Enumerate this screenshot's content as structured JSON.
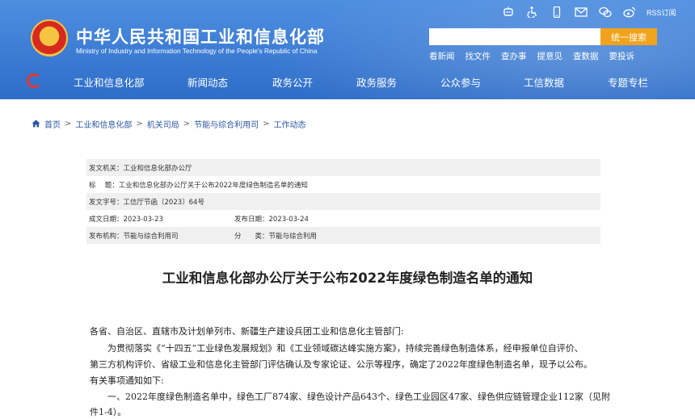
{
  "header": {
    "title": "中华人民共和国工业和信息化部",
    "subtitle": "Ministry of Industry and Information Technology of the People's Republic of China",
    "rss_label": "RSS订阅",
    "search": {
      "placeholder": "",
      "button_label": "统一搜索"
    },
    "quick_links": [
      "看新闻",
      "找文件",
      "查办事",
      "提意见",
      "查数据",
      "要投诉"
    ],
    "top_icons": [
      "robot-icon",
      "accessibility-icon",
      "mobile-icon",
      "mail-icon",
      "wechat-icon",
      "weibo-icon"
    ]
  },
  "nav": {
    "items": [
      "工业和信息化部",
      "新闻动态",
      "政务公开",
      "政务服务",
      "公众参与",
      "工信数据",
      "专题专栏"
    ]
  },
  "breadcrumb": [
    "首页",
    "工业和信息化部",
    "机关司局",
    "节能与综合利用司",
    "工作动态"
  ],
  "meta": {
    "issuer": "发文机关：工业和信息化部办公厅",
    "subject": "标　 题：工业和信息化部办公厅关于公布2022年度绿色制造名单的通知",
    "doc_number": "发文字号：工信厅节函〔2023〕64号",
    "created": "成文日期：2023-03-23",
    "published": "发布日期：2023-03-24",
    "publisher": "发布机构：节能与综合利用司",
    "category": "分　　类：节能与综合利用"
  },
  "article": {
    "title": "工业和信息化部办公厅关于公布2022年度绿色制造名单的通知",
    "lines": [
      "各省、自治区、直辖市及计划单列市、新疆生产建设兵团工业和信息化主管部门:",
      "　　为贯彻落实《“十四五”工业绿色发展规划》和《工业领域碳达峰实施方案》，持续完善绿色制造体系，经申报单位自评价、",
      "第三方机构评价、省级工业和信息化主管部门评估确认及专家论证、公示等程序，确定了2022年度绿色制造名单，现予以公布。",
      "有关事项通知如下:",
      "　　一、2022年度绿色制造名单中，绿色工厂874家、绿色设计产品643个、绿色工业园区47家、绿色供应链管理企业112家（见附",
      "件1-4）。"
    ]
  }
}
